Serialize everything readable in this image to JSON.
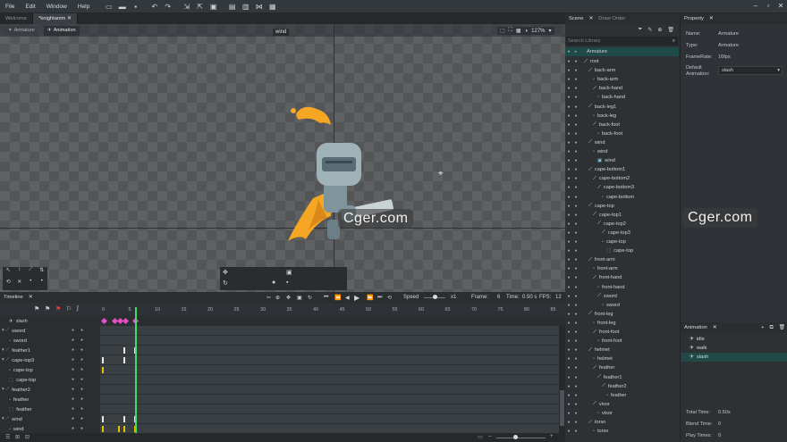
{
  "menu": {
    "file": "File",
    "edit": "Edit",
    "window": "Window",
    "help": "Help"
  },
  "tabs": {
    "welcome": "Welcome",
    "knight": "*knightanim"
  },
  "viewport": {
    "mode_armature": "Armature",
    "mode_animation": "Animation",
    "hover_label": "wind",
    "zoom": "127%"
  },
  "watermark": "Cger.com",
  "timeline": {
    "title": "Timeline",
    "speed_label": "Speed",
    "speed_value": "x1",
    "frame_label": "Frame:",
    "frame_value": "6",
    "time_label": "Time:",
    "time_value": "0.50 s",
    "fps_label": "FPS:",
    "fps_value": "12",
    "ruler": [
      "0",
      "5",
      "10",
      "15",
      "20",
      "25",
      "30",
      "35",
      "40",
      "45",
      "50",
      "55",
      "60",
      "65",
      "70",
      "75",
      "80",
      "85"
    ],
    "animation_name": "slash",
    "rows": [
      {
        "name": "sword",
        "type": "bone"
      },
      {
        "name": "sword",
        "type": "slot"
      },
      {
        "name": "feather1",
        "type": "bone"
      },
      {
        "name": "cape-top3",
        "type": "bone"
      },
      {
        "name": "cape-top",
        "type": "slot"
      },
      {
        "name": "cape-top",
        "type": "mesh"
      },
      {
        "name": "feather2",
        "type": "bone"
      },
      {
        "name": "feather",
        "type": "slot"
      },
      {
        "name": "feather",
        "type": "mesh"
      },
      {
        "name": "wind",
        "type": "bone"
      },
      {
        "name": "wind",
        "type": "slot"
      }
    ]
  },
  "scene": {
    "tab_scene": "Scene",
    "tab_draw": "Draw Order",
    "search_placeholder": "Search Library",
    "root_label": "Armature",
    "items": [
      [
        "root",
        1,
        "bone"
      ],
      [
        "back-arm",
        2,
        "bone"
      ],
      [
        "back-arm",
        3,
        "slot"
      ],
      [
        "back-hand",
        3,
        "bone"
      ],
      [
        "back-hand",
        4,
        "slot"
      ],
      [
        "back-leg1",
        2,
        "bone"
      ],
      [
        "back-leg",
        3,
        "slot"
      ],
      [
        "back-foot",
        3,
        "bone"
      ],
      [
        "back-foot",
        4,
        "slot"
      ],
      [
        "wind",
        2,
        "bone"
      ],
      [
        "wind",
        3,
        "slot"
      ],
      [
        "wind",
        4,
        "img"
      ],
      [
        "cape-bottom1",
        2,
        "bone"
      ],
      [
        "cape-bottom2",
        3,
        "bone"
      ],
      [
        "cape-bottom3",
        4,
        "bone"
      ],
      [
        "cape-bottom",
        5,
        "slot"
      ],
      [
        "cape-top",
        2,
        "bone"
      ],
      [
        "cape-top1",
        3,
        "bone"
      ],
      [
        "cape-top2",
        4,
        "bone"
      ],
      [
        "cape-top3",
        5,
        "bone"
      ],
      [
        "cape-top",
        5,
        "slot"
      ],
      [
        "cape-top",
        6,
        "mesh"
      ],
      [
        "front-arm",
        2,
        "bone"
      ],
      [
        "front-arm",
        3,
        "slot"
      ],
      [
        "front-hand",
        3,
        "bone"
      ],
      [
        "front-hand",
        4,
        "slot"
      ],
      [
        "sword",
        4,
        "bone"
      ],
      [
        "sword",
        5,
        "slot"
      ],
      [
        "front-leg",
        2,
        "bone"
      ],
      [
        "front-leg",
        3,
        "slot"
      ],
      [
        "front-foot",
        3,
        "bone"
      ],
      [
        "front-foot",
        4,
        "slot"
      ],
      [
        "helmet",
        2,
        "bone"
      ],
      [
        "helmet",
        3,
        "slot"
      ],
      [
        "feather",
        3,
        "bone"
      ],
      [
        "feather1",
        4,
        "bone"
      ],
      [
        "feather2",
        5,
        "bone"
      ],
      [
        "feather",
        6,
        "slot"
      ],
      [
        "visor",
        3,
        "bone"
      ],
      [
        "visor",
        4,
        "slot"
      ],
      [
        "torso",
        2,
        "bone"
      ],
      [
        "torso",
        3,
        "slot"
      ]
    ]
  },
  "property": {
    "title": "Property",
    "name_label": "Name:",
    "name_value": "Armature",
    "type_label": "Type:",
    "type_value": "Armature",
    "framerate_label": "FrameRate:",
    "framerate_value": "16fps",
    "default_label": "Default",
    "animation_label": "Animation:",
    "default_value": "slash"
  },
  "animation": {
    "title": "Animation",
    "items": [
      "idle",
      "walk",
      "slash"
    ],
    "selected": "slash",
    "total_label": "Total Time:",
    "total_value": "0.50s",
    "blend_label": "Blend Time:",
    "blend_value": "0",
    "play_label": "Play Times:",
    "play_value": "0"
  },
  "colors": {
    "accent": "#1c6b66",
    "selected_row": "#245a57",
    "playhead": "#3ddc6b",
    "keyframe": "#e050c0",
    "cape": "#f5a623"
  }
}
